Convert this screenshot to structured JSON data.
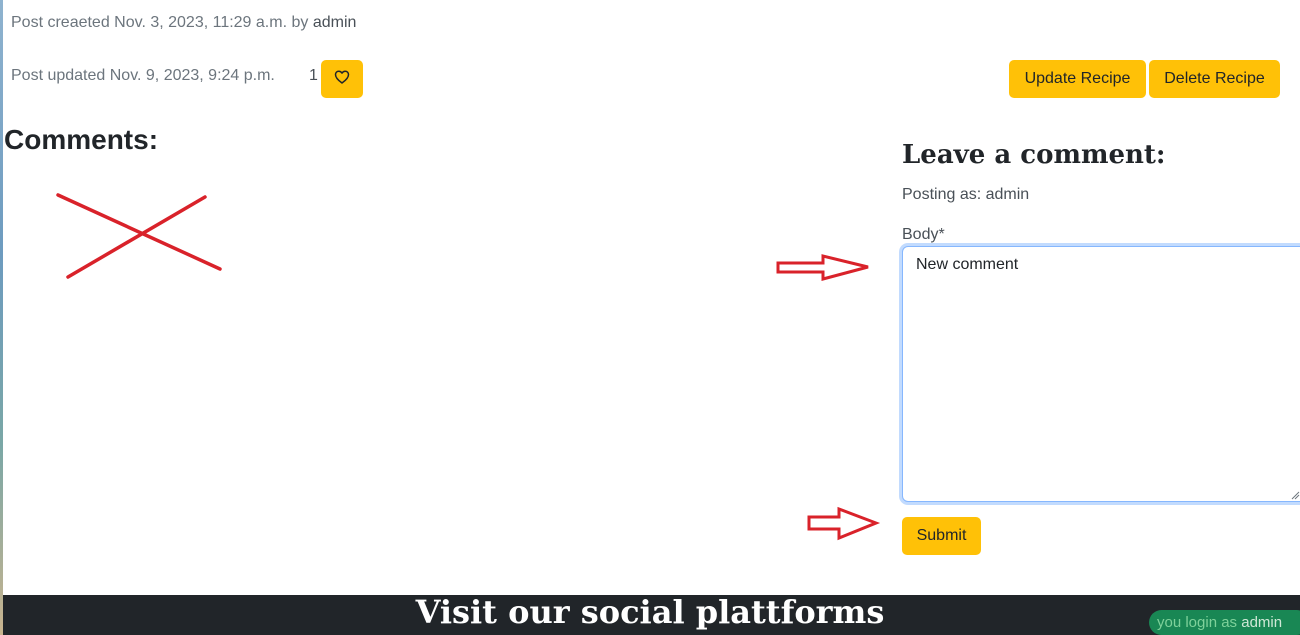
{
  "post_meta": {
    "created_prefix": "Post creaeted Nov. 3, 2023, 11:29 a.m. by ",
    "created_author": "admin",
    "updated_text": "Post updated Nov. 9, 2023, 9:24 p.m.",
    "like_count": "1",
    "like_icon": "heart-outline-icon"
  },
  "actions": {
    "update_label": "Update Recipe",
    "delete_label": "Delete Recipe"
  },
  "comments": {
    "heading": "Comments:"
  },
  "comment_form": {
    "heading": "Leave a comment:",
    "posting_as": "Posting as: admin",
    "body_label": "Body*",
    "body_value": "New comment",
    "submit_label": "Submit"
  },
  "footer": {
    "title": "Visit our social plattforms",
    "login_prefix": "you login as ",
    "login_user": "admin"
  },
  "colors": {
    "accent": "#ffc107",
    "footer_bg": "#212529",
    "annotation": "#d9222a",
    "badge": "#198754"
  }
}
